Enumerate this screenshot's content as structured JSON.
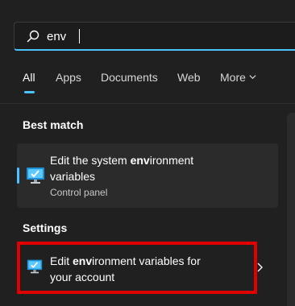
{
  "search": {
    "value": "env",
    "placeholder": ""
  },
  "tabs": [
    {
      "label": "All"
    },
    {
      "label": "Apps"
    },
    {
      "label": "Documents"
    },
    {
      "label": "Web"
    },
    {
      "label": "More"
    }
  ],
  "sections": {
    "best_match": "Best match",
    "settings": "Settings"
  },
  "best_match": {
    "title_pre": "Edit the system ",
    "title_bold": "env",
    "title_post": "ironment",
    "title_line2": "variables",
    "subtitle": "Control panel",
    "icon": "control-panel-monitor-icon"
  },
  "settings_result": {
    "title_pre": "Edit ",
    "title_bold": "env",
    "title_post": "ironment variables for",
    "title_line2": "your account",
    "icon": "settings-monitor-icon"
  },
  "colors": {
    "accent": "#4cc2ff",
    "highlight": "#e00000",
    "background": "#202020"
  }
}
